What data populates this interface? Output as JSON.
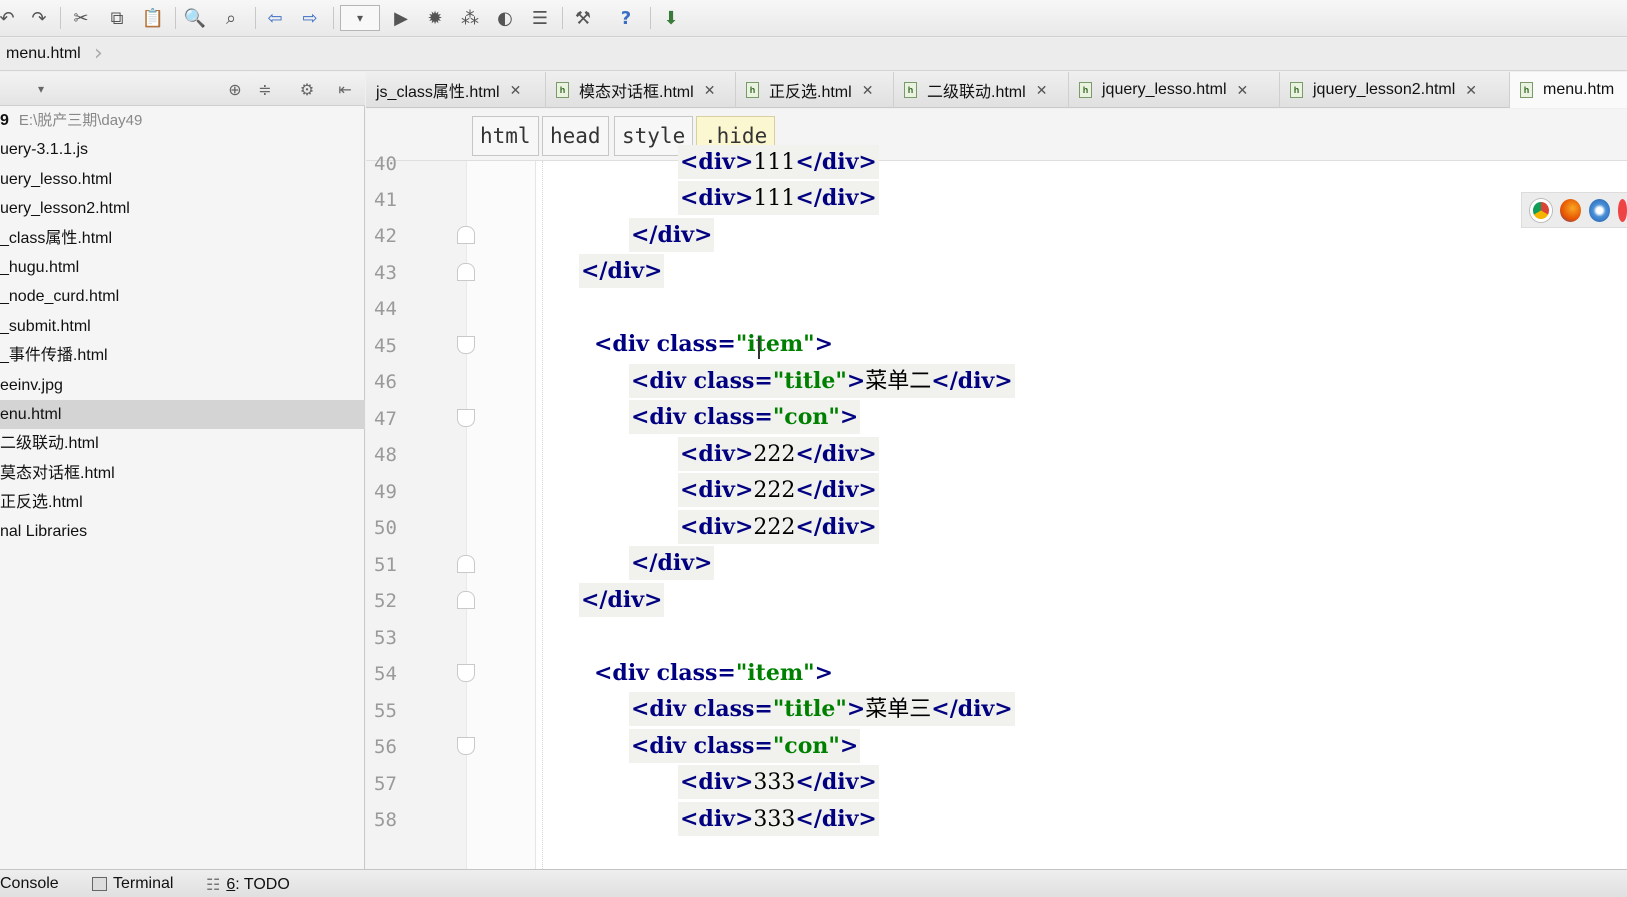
{
  "toolbar": {
    "icons": [
      "undo-icon",
      "redo-icon",
      "cut-icon",
      "copy-icon",
      "paste-icon",
      "find-icon",
      "replace-icon",
      "back-icon",
      "forward-icon",
      "run-config-icon",
      "run-icon",
      "debug-icon",
      "coverage-icon",
      "profile-icon",
      "build-icon",
      "settings-icon",
      "help-icon",
      "update-icon"
    ]
  },
  "breadcrumb": {
    "file": "menu.html"
  },
  "sidebar": {
    "items": [
      {
        "label": "9",
        "path": "E:\\脱产三期\\day49",
        "bold": true
      },
      {
        "label": "uery-3.1.1.js"
      },
      {
        "label": "uery_lesso.html"
      },
      {
        "label": "uery_lesson2.html"
      },
      {
        "label": "_class属性.html"
      },
      {
        "label": "_hugu.html"
      },
      {
        "label": "_node_curd.html"
      },
      {
        "label": "_submit.html"
      },
      {
        "label": "_事件传播.html"
      },
      {
        "label": "eeinv.jpg"
      },
      {
        "label": "enu.html",
        "selected": true
      },
      {
        "label": "二级联动.html"
      },
      {
        "label": "莫态对话框.html"
      },
      {
        "label": "正反选.html"
      },
      {
        "label": "nal Libraries"
      }
    ]
  },
  "tabs": [
    {
      "label": "js_class属性.html",
      "icon": false
    },
    {
      "label": "模态对话框.html",
      "icon": true
    },
    {
      "label": "正反选.html",
      "icon": true
    },
    {
      "label": "二级联动.html",
      "icon": true
    },
    {
      "label": "jquery_lesso.html",
      "icon": true
    },
    {
      "label": "jquery_lesson2.html",
      "icon": true
    },
    {
      "label": "menu.htm",
      "icon": true,
      "active": true
    }
  ],
  "editor": {
    "crumbs": [
      "html",
      "head",
      "style",
      ".hide"
    ],
    "line_numbers": [
      "40",
      "41",
      "42",
      "43",
      "44",
      "45",
      "46",
      "47",
      "48",
      "49",
      "50",
      "51",
      "52",
      "53",
      "54",
      "55",
      "56",
      "57",
      "58"
    ],
    "lines": {
      "l40": "111",
      "l41": "111",
      "l46": "菜单二",
      "l48": "222",
      "l49": "222",
      "l50": "222",
      "l55": "菜单三",
      "l57": "333",
      "l58": "333"
    },
    "tokens": {
      "div_open": "<div>",
      "div_close": "</div>",
      "div_class": "<div class=",
      "item": "\"item\"",
      "title": "\"title\"",
      "con": "\"con\"",
      "gt": ">"
    }
  },
  "statusbar": {
    "console": "Console",
    "terminal": "Terminal",
    "todo_num": "6",
    "todo": ": TODO"
  }
}
